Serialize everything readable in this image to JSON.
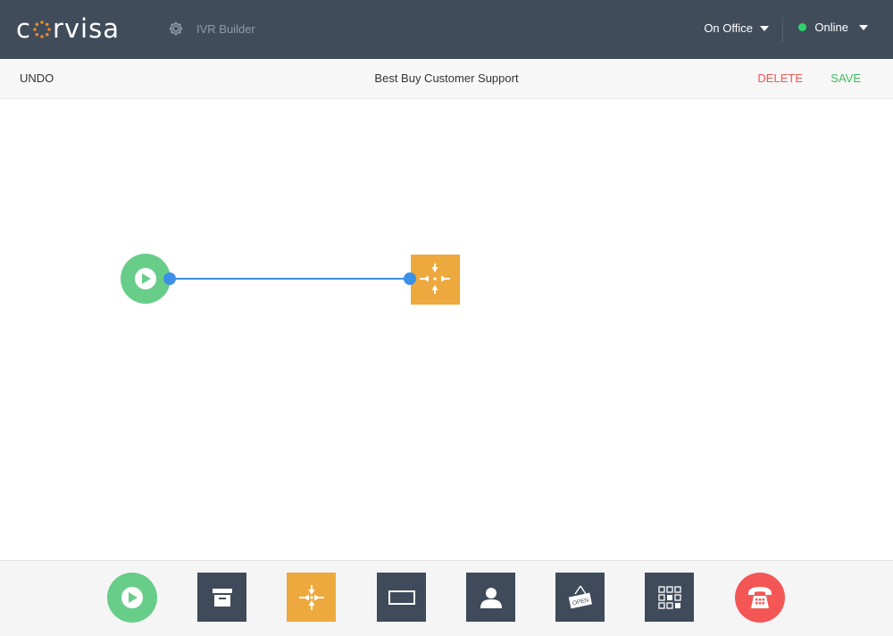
{
  "app": {
    "logo_text": "corvisa",
    "nav_label": "IVR Builder",
    "office_label": "On Office",
    "status_label": "Online",
    "status_color": "#2fd26a"
  },
  "toolbar": {
    "undo_label": "UNDO",
    "title": "Best Buy Customer Support",
    "delete_label": "DELETE",
    "save_label": "SAVE"
  },
  "canvas": {
    "nodes": [
      {
        "type": "start",
        "icon": "play-icon",
        "color": "#69cd8a"
      },
      {
        "type": "merge",
        "icon": "merge-arrows-icon",
        "color": "#eda93d"
      }
    ],
    "connection_color": "#3b90e8"
  },
  "palette": {
    "tools": [
      {
        "name": "start",
        "icon": "play-icon",
        "color": "#69cd8a"
      },
      {
        "name": "archive",
        "icon": "archive-box-icon",
        "color": "#3f4b5a"
      },
      {
        "name": "merge",
        "icon": "merge-arrows-icon",
        "color": "#eda93d"
      },
      {
        "name": "message",
        "icon": "rectangle-icon",
        "color": "#3f4b5a"
      },
      {
        "name": "agent",
        "icon": "person-icon",
        "color": "#3f4b5a"
      },
      {
        "name": "hours",
        "icon": "open-sign-icon",
        "color": "#3f4b5a"
      },
      {
        "name": "keypad",
        "icon": "keypad-grid-icon",
        "color": "#3f4b5a"
      },
      {
        "name": "hangup",
        "icon": "phone-icon",
        "color": "#f35654"
      }
    ],
    "open_sign_text": "OPEN"
  }
}
